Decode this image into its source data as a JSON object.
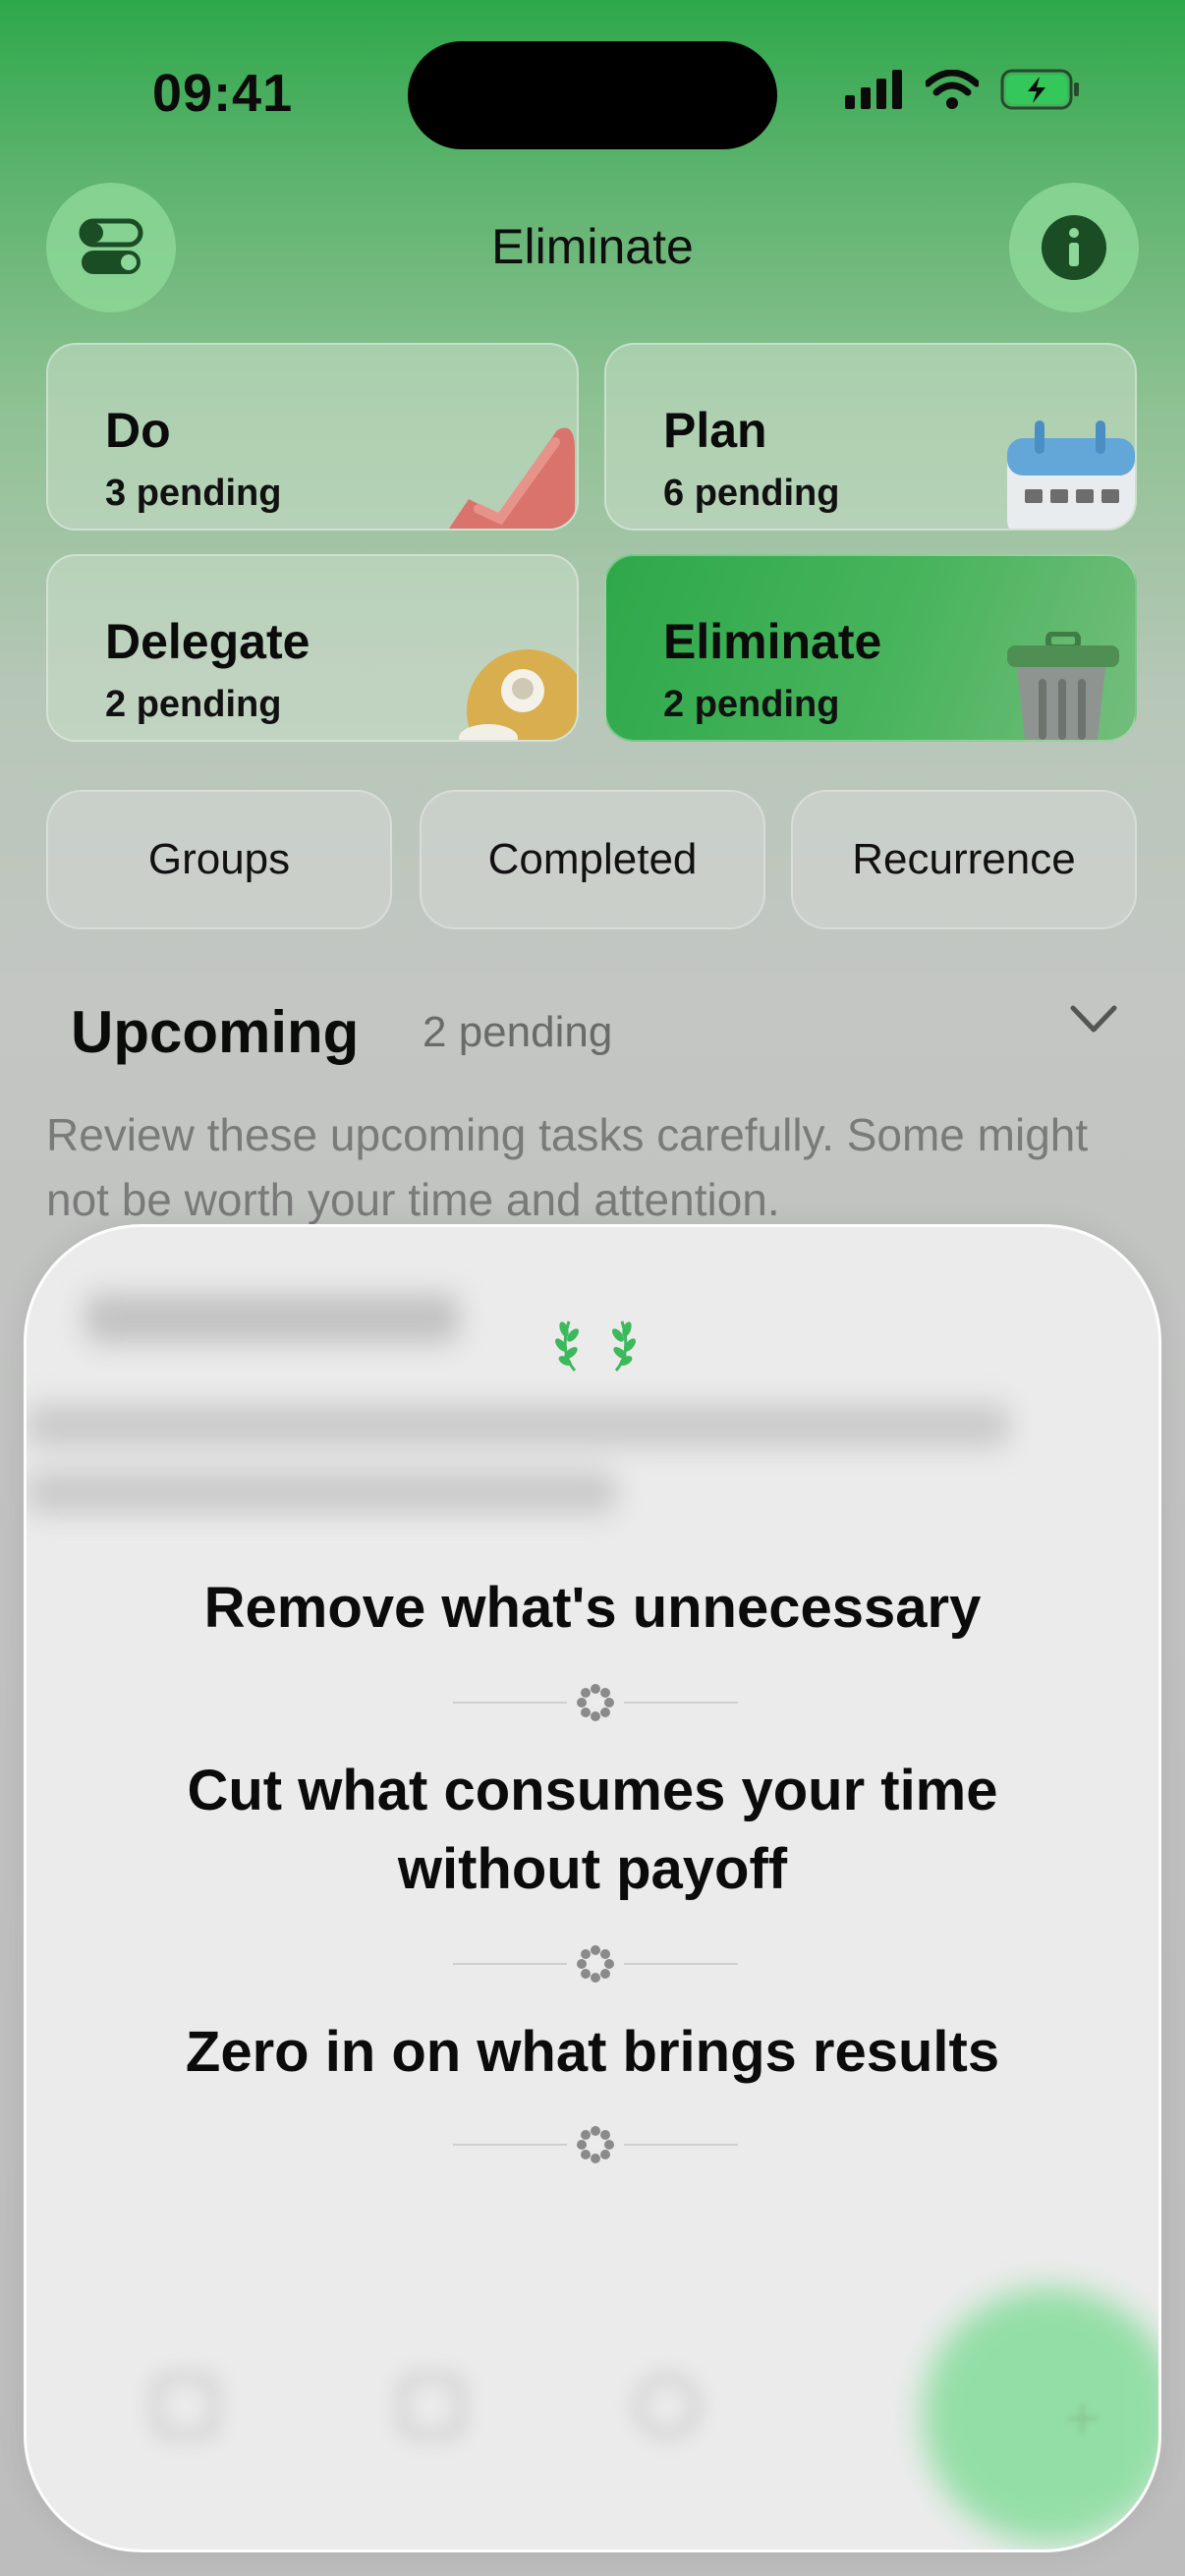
{
  "status_bar": {
    "time": "09:41"
  },
  "header": {
    "title": "Eliminate"
  },
  "quadrants": [
    {
      "title": "Do",
      "count": "3 pending"
    },
    {
      "title": "Plan",
      "count": "6 pending"
    },
    {
      "title": "Delegate",
      "count": "2 pending"
    },
    {
      "title": "Eliminate",
      "count": "2 pending"
    }
  ],
  "filters": [
    "Groups",
    "Completed",
    "Recurrence"
  ],
  "upcoming": {
    "title": "Upcoming",
    "count": "2 pending",
    "description": "Review these upcoming tasks carefully. Some might not be worth your time and attention."
  },
  "sheet": {
    "line1": "Remove what's unnecessary",
    "line2a": "Cut what consumes your time",
    "line2b": "without payoff",
    "line3": "Zero in on what brings results"
  },
  "colors": {
    "accent": "#2ea84a",
    "sheet_bg": "#ececec"
  }
}
